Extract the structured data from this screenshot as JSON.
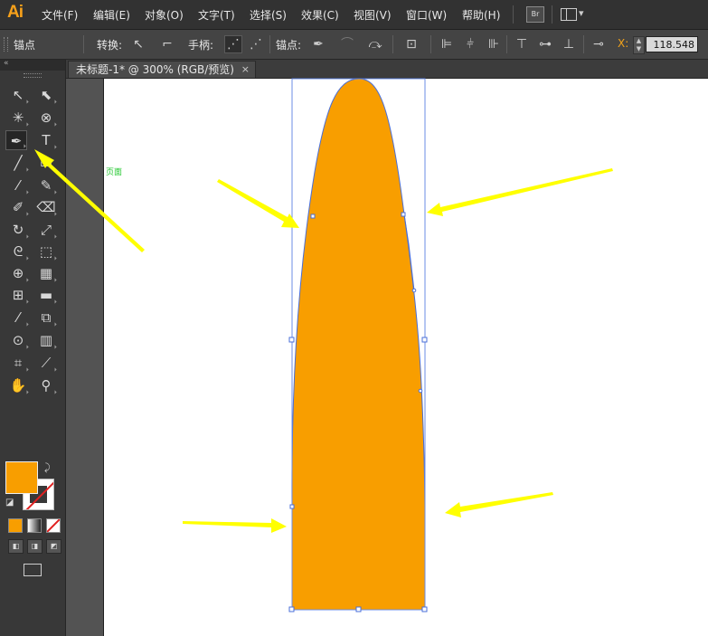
{
  "app": {
    "logo": "Ai"
  },
  "menu": {
    "items": [
      "文件(F)",
      "编辑(E)",
      "对象(O)",
      "文字(T)",
      "选择(S)",
      "效果(C)",
      "视图(V)",
      "窗口(W)",
      "帮助(H)"
    ],
    "bridge_label": "Br"
  },
  "control_bar": {
    "tool_name": "锚点",
    "convert_label": "转换:",
    "handles_label": "手柄:",
    "anchors_label": "锚点:",
    "x_label": "X:",
    "x_value": "118.548"
  },
  "tabs": [
    {
      "title": "未标题-1* @ 300% (RGB/预览)",
      "close": "×"
    }
  ],
  "canvas": {
    "artboard_label": "页面",
    "shape_fill": "#F89E00",
    "selection_color": "#4A6FD8",
    "annotation_color": "#FFFF00",
    "artboard_color": "#FFFFFF",
    "pasteboard_color": "#535353"
  },
  "tools": {
    "fill_color": "#F89E00",
    "stroke": "none",
    "active_tool": "add-anchor-point-tool"
  }
}
